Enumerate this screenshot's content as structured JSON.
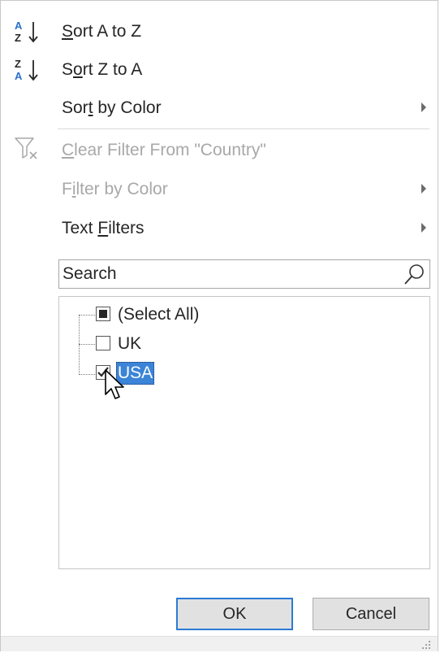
{
  "menu": {
    "sort_az": {
      "prefix": "",
      "underline": "S",
      "suffix": "ort A to Z"
    },
    "sort_za": {
      "prefix": "S",
      "underline": "o",
      "suffix": "rt Z to A"
    },
    "sort_by_color": {
      "prefix": "Sor",
      "underline": "t",
      "suffix": " by Color"
    },
    "clear_filter": {
      "prefix": "",
      "underline": "C",
      "suffix": "lear Filter From \"Country\""
    },
    "filter_by_color": {
      "prefix": "F",
      "underline": "i",
      "suffix": "lter by Color"
    },
    "text_filters": {
      "prefix": "Text ",
      "underline": "F",
      "suffix": "ilters"
    }
  },
  "icons": {
    "sort_az": "sort-ascending-icon",
    "sort_za": "sort-descending-icon",
    "clear_filter": "clear-filter-icon",
    "search": "search-icon"
  },
  "colors": {
    "accent": "#2b7bd4",
    "selection": "#3b84d8",
    "disabled_text": "#a8a8a8",
    "sort_icon_blue": "#2a6fc9"
  },
  "search": {
    "placeholder": "Search",
    "value": ""
  },
  "filter_list": {
    "items": [
      {
        "label": "(Select All)",
        "state": "partial"
      },
      {
        "label": "UK",
        "state": "unchecked"
      },
      {
        "label": "USA",
        "state": "checked",
        "selected": true
      }
    ]
  },
  "buttons": {
    "ok": "OK",
    "cancel": "Cancel"
  }
}
